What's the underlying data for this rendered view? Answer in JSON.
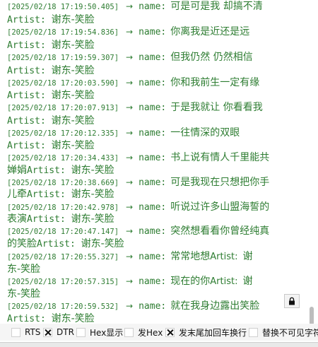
{
  "log": {
    "arrow": "→",
    "name_label": "name:",
    "entries": [
      {
        "timestamp": "[2025/02/18 17:19:50.405]",
        "lyric": "可是可是我   却搞不清",
        "artist_label": "Artist:",
        "artist_name": "谢东-笑脸"
      },
      {
        "timestamp": "[2025/02/18 17:19:54.836]",
        "lyric": "你离我是近还是远",
        "artist_label": "Artist:",
        "artist_name": "谢东-笑脸"
      },
      {
        "timestamp": "[2025/02/18 17:19:59.307]",
        "lyric": "但我仍然   仍然相信",
        "artist_label": "Artist:",
        "artist_name": "谢东-笑脸"
      },
      {
        "timestamp": "[2025/02/18 17:20:03.590]",
        "lyric": "你和我前生一定有缘",
        "artist_label": "Artist:",
        "artist_name": "谢东-笑脸"
      },
      {
        "timestamp": "[2025/02/18 17:20:07.913]",
        "lyric": "于是我就让   你看看我",
        "artist_label": "Artist:",
        "artist_name": "谢东-笑脸"
      },
      {
        "timestamp": "[2025/02/18 17:20:12.335]",
        "lyric": "一往情深的双眼",
        "artist_label": "Artist:",
        "artist_name": "谢东-笑脸"
      },
      {
        "timestamp": "[2025/02/18 17:20:34.433]",
        "lyric": "书上说有情人千里能共",
        "lyric_wrap": "婵娟",
        "artist_label": "Artist:",
        "artist_name": "谢东-笑脸"
      },
      {
        "timestamp": "[2025/02/18 17:20:38.669]",
        "lyric": "可是我现在只想把你手",
        "lyric_wrap": "儿牵",
        "artist_label": "Artist:",
        "artist_name": "谢东-笑脸"
      },
      {
        "timestamp": "[2025/02/18 17:20:42.978]",
        "lyric": "听说过许多山盟海誓的",
        "lyric_wrap": "表演",
        "artist_label": "Artist:",
        "artist_name": "谢东-笑脸"
      },
      {
        "timestamp": "[2025/02/18 17:20:47.147]",
        "lyric": "突然想看看你曾经纯真",
        "lyric_wrap": "的笑脸",
        "artist_label": "Artist:",
        "artist_name": "谢东-笑脸"
      },
      {
        "timestamp": "[2025/02/18 17:20:55.327]",
        "lyric": "常常地想",
        "artist_label": "Artist:",
        "artist_name": "谢",
        "artist_name_wrap": "东-笑脸"
      },
      {
        "timestamp": "[2025/02/18 17:20:57.315]",
        "lyric": "现在的你",
        "artist_label": "Artist:",
        "artist_name": "谢",
        "artist_name_wrap": "东-笑脸"
      },
      {
        "timestamp": "[2025/02/18 17:20:59.532]",
        "lyric": "就在我身边露出笑脸",
        "artist_label": "Artist:",
        "artist_name": "谢东-笑脸"
      }
    ]
  },
  "lock_button": {
    "icon": "lock-icon"
  },
  "options": [
    {
      "id": "rts",
      "label": "RTS",
      "checked": false
    },
    {
      "id": "dtr",
      "label": "DTR",
      "checked": true
    },
    {
      "id": "hex-display",
      "label": "Hex显示",
      "checked": false
    },
    {
      "id": "send-hex",
      "label": "发Hex",
      "checked": true
    },
    {
      "id": "send-newline",
      "label": "发末尾加回车换行",
      "checked": false
    },
    {
      "id": "replace-invisible",
      "label": "替换不可见字符",
      "checked": false
    }
  ]
}
